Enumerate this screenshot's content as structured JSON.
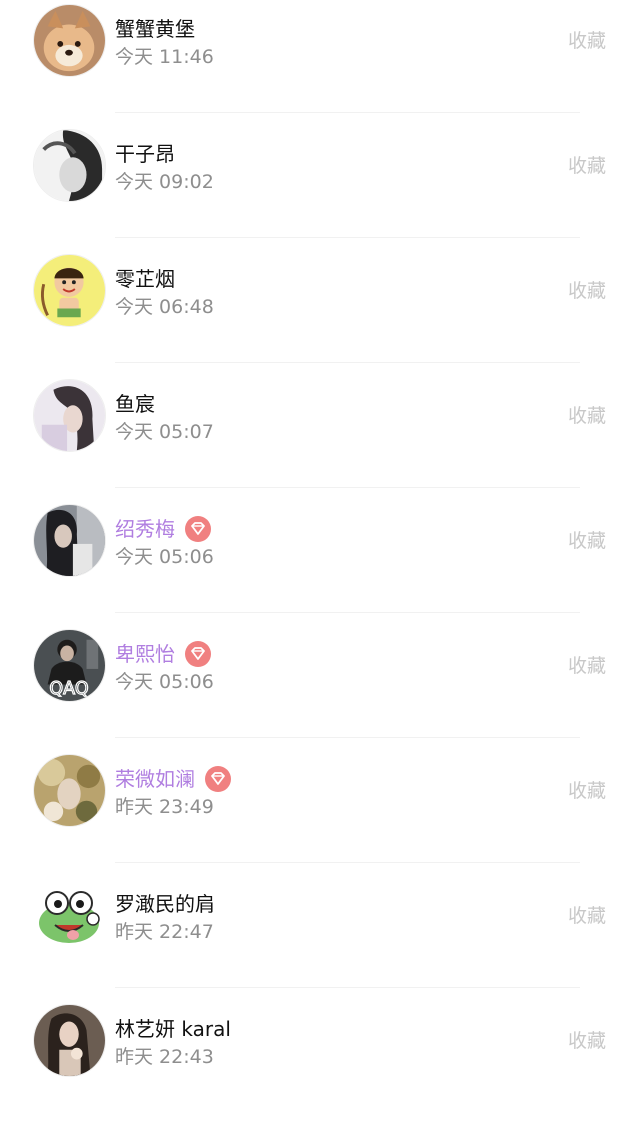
{
  "favorite_label": "收藏",
  "colors": {
    "vip_name": "#b07ee0",
    "vip_badge": "#f08080",
    "time": "#8e8e8e",
    "favorite": "#c8c8c8"
  },
  "users": [
    {
      "name": "蟹蟹黄堡",
      "time": "今天 11:46",
      "vip": false,
      "avatar": "shiba-dog-avatar"
    },
    {
      "name": "干子昂",
      "time": "今天 09:02",
      "vip": false,
      "avatar": "monochrome-portrait-avatar"
    },
    {
      "name": "零芷烟",
      "time": "今天 06:48",
      "vip": false,
      "avatar": "cartoon-archer-avatar"
    },
    {
      "name": "鱼宸",
      "time": "今天 05:07",
      "vip": false,
      "avatar": "long-hair-portrait-avatar"
    },
    {
      "name": "绍秀梅",
      "time": "今天 05:06",
      "vip": true,
      "avatar": "dark-portrait-avatar"
    },
    {
      "name": "卑熙怡",
      "time": "今天 05:06",
      "vip": true,
      "avatar": "qaq-portrait-avatar"
    },
    {
      "name": "荣微如澜",
      "time": "昨天 23:49",
      "vip": true,
      "avatar": "blurred-photo-avatar"
    },
    {
      "name": "罗澉民的肩",
      "time": "昨天 22:47",
      "vip": false,
      "avatar": "green-frog-avatar"
    },
    {
      "name": "林艺妍 karal",
      "time": "昨天 22:43",
      "vip": false,
      "avatar": "girl-portrait-avatar"
    }
  ]
}
